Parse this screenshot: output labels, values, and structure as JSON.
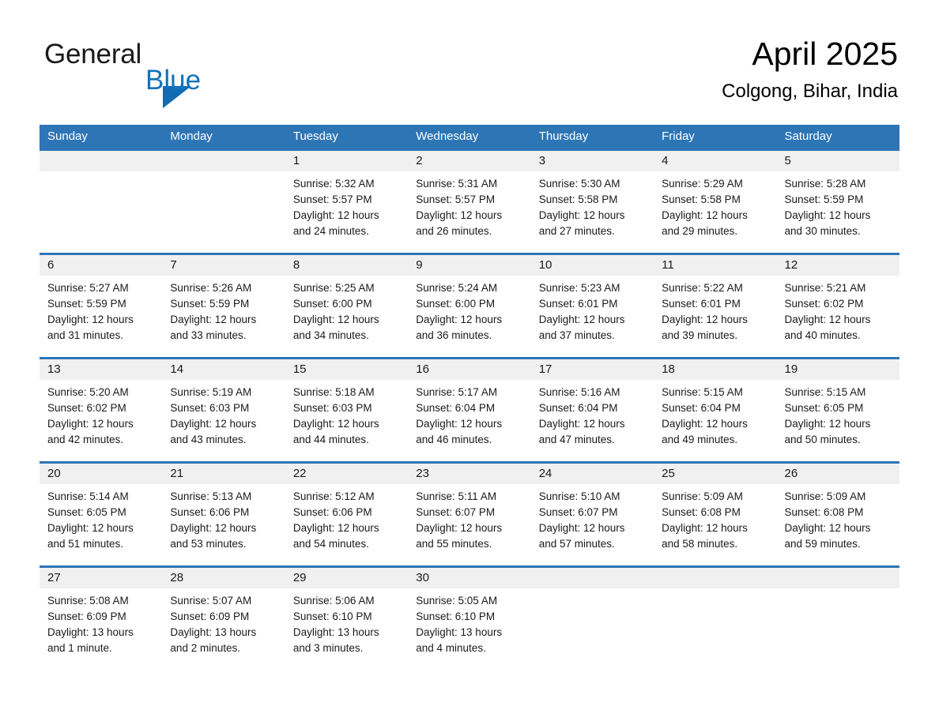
{
  "brand": {
    "name_part1": "General",
    "name_part2": "Blue",
    "triangle_icon": "triangle-icon",
    "accent_color": "#1373bb",
    "header_color": "#2e75b6"
  },
  "header": {
    "title": "April 2025",
    "subtitle": "Colgong, Bihar, India"
  },
  "weekdays": [
    "Sunday",
    "Monday",
    "Tuesday",
    "Wednesday",
    "Thursday",
    "Friday",
    "Saturday"
  ],
  "weeks": [
    [
      {
        "day": "",
        "sunrise": "",
        "sunset": "",
        "daylight": ""
      },
      {
        "day": "",
        "sunrise": "",
        "sunset": "",
        "daylight": ""
      },
      {
        "day": "1",
        "sunrise": "Sunrise: 5:32 AM",
        "sunset": "Sunset: 5:57 PM",
        "daylight": "Daylight: 12 hours and 24 minutes."
      },
      {
        "day": "2",
        "sunrise": "Sunrise: 5:31 AM",
        "sunset": "Sunset: 5:57 PM",
        "daylight": "Daylight: 12 hours and 26 minutes."
      },
      {
        "day": "3",
        "sunrise": "Sunrise: 5:30 AM",
        "sunset": "Sunset: 5:58 PM",
        "daylight": "Daylight: 12 hours and 27 minutes."
      },
      {
        "day": "4",
        "sunrise": "Sunrise: 5:29 AM",
        "sunset": "Sunset: 5:58 PM",
        "daylight": "Daylight: 12 hours and 29 minutes."
      },
      {
        "day": "5",
        "sunrise": "Sunrise: 5:28 AM",
        "sunset": "Sunset: 5:59 PM",
        "daylight": "Daylight: 12 hours and 30 minutes."
      }
    ],
    [
      {
        "day": "6",
        "sunrise": "Sunrise: 5:27 AM",
        "sunset": "Sunset: 5:59 PM",
        "daylight": "Daylight: 12 hours and 31 minutes."
      },
      {
        "day": "7",
        "sunrise": "Sunrise: 5:26 AM",
        "sunset": "Sunset: 5:59 PM",
        "daylight": "Daylight: 12 hours and 33 minutes."
      },
      {
        "day": "8",
        "sunrise": "Sunrise: 5:25 AM",
        "sunset": "Sunset: 6:00 PM",
        "daylight": "Daylight: 12 hours and 34 minutes."
      },
      {
        "day": "9",
        "sunrise": "Sunrise: 5:24 AM",
        "sunset": "Sunset: 6:00 PM",
        "daylight": "Daylight: 12 hours and 36 minutes."
      },
      {
        "day": "10",
        "sunrise": "Sunrise: 5:23 AM",
        "sunset": "Sunset: 6:01 PM",
        "daylight": "Daylight: 12 hours and 37 minutes."
      },
      {
        "day": "11",
        "sunrise": "Sunrise: 5:22 AM",
        "sunset": "Sunset: 6:01 PM",
        "daylight": "Daylight: 12 hours and 39 minutes."
      },
      {
        "day": "12",
        "sunrise": "Sunrise: 5:21 AM",
        "sunset": "Sunset: 6:02 PM",
        "daylight": "Daylight: 12 hours and 40 minutes."
      }
    ],
    [
      {
        "day": "13",
        "sunrise": "Sunrise: 5:20 AM",
        "sunset": "Sunset: 6:02 PM",
        "daylight": "Daylight: 12 hours and 42 minutes."
      },
      {
        "day": "14",
        "sunrise": "Sunrise: 5:19 AM",
        "sunset": "Sunset: 6:03 PM",
        "daylight": "Daylight: 12 hours and 43 minutes."
      },
      {
        "day": "15",
        "sunrise": "Sunrise: 5:18 AM",
        "sunset": "Sunset: 6:03 PM",
        "daylight": "Daylight: 12 hours and 44 minutes."
      },
      {
        "day": "16",
        "sunrise": "Sunrise: 5:17 AM",
        "sunset": "Sunset: 6:04 PM",
        "daylight": "Daylight: 12 hours and 46 minutes."
      },
      {
        "day": "17",
        "sunrise": "Sunrise: 5:16 AM",
        "sunset": "Sunset: 6:04 PM",
        "daylight": "Daylight: 12 hours and 47 minutes."
      },
      {
        "day": "18",
        "sunrise": "Sunrise: 5:15 AM",
        "sunset": "Sunset: 6:04 PM",
        "daylight": "Daylight: 12 hours and 49 minutes."
      },
      {
        "day": "19",
        "sunrise": "Sunrise: 5:15 AM",
        "sunset": "Sunset: 6:05 PM",
        "daylight": "Daylight: 12 hours and 50 minutes."
      }
    ],
    [
      {
        "day": "20",
        "sunrise": "Sunrise: 5:14 AM",
        "sunset": "Sunset: 6:05 PM",
        "daylight": "Daylight: 12 hours and 51 minutes."
      },
      {
        "day": "21",
        "sunrise": "Sunrise: 5:13 AM",
        "sunset": "Sunset: 6:06 PM",
        "daylight": "Daylight: 12 hours and 53 minutes."
      },
      {
        "day": "22",
        "sunrise": "Sunrise: 5:12 AM",
        "sunset": "Sunset: 6:06 PM",
        "daylight": "Daylight: 12 hours and 54 minutes."
      },
      {
        "day": "23",
        "sunrise": "Sunrise: 5:11 AM",
        "sunset": "Sunset: 6:07 PM",
        "daylight": "Daylight: 12 hours and 55 minutes."
      },
      {
        "day": "24",
        "sunrise": "Sunrise: 5:10 AM",
        "sunset": "Sunset: 6:07 PM",
        "daylight": "Daylight: 12 hours and 57 minutes."
      },
      {
        "day": "25",
        "sunrise": "Sunrise: 5:09 AM",
        "sunset": "Sunset: 6:08 PM",
        "daylight": "Daylight: 12 hours and 58 minutes."
      },
      {
        "day": "26",
        "sunrise": "Sunrise: 5:09 AM",
        "sunset": "Sunset: 6:08 PM",
        "daylight": "Daylight: 12 hours and 59 minutes."
      }
    ],
    [
      {
        "day": "27",
        "sunrise": "Sunrise: 5:08 AM",
        "sunset": "Sunset: 6:09 PM",
        "daylight": "Daylight: 13 hours and 1 minute."
      },
      {
        "day": "28",
        "sunrise": "Sunrise: 5:07 AM",
        "sunset": "Sunset: 6:09 PM",
        "daylight": "Daylight: 13 hours and 2 minutes."
      },
      {
        "day": "29",
        "sunrise": "Sunrise: 5:06 AM",
        "sunset": "Sunset: 6:10 PM",
        "daylight": "Daylight: 13 hours and 3 minutes."
      },
      {
        "day": "30",
        "sunrise": "Sunrise: 5:05 AM",
        "sunset": "Sunset: 6:10 PM",
        "daylight": "Daylight: 13 hours and 4 minutes."
      },
      {
        "day": "",
        "sunrise": "",
        "sunset": "",
        "daylight": ""
      },
      {
        "day": "",
        "sunrise": "",
        "sunset": "",
        "daylight": ""
      },
      {
        "day": "",
        "sunrise": "",
        "sunset": "",
        "daylight": ""
      }
    ]
  ]
}
